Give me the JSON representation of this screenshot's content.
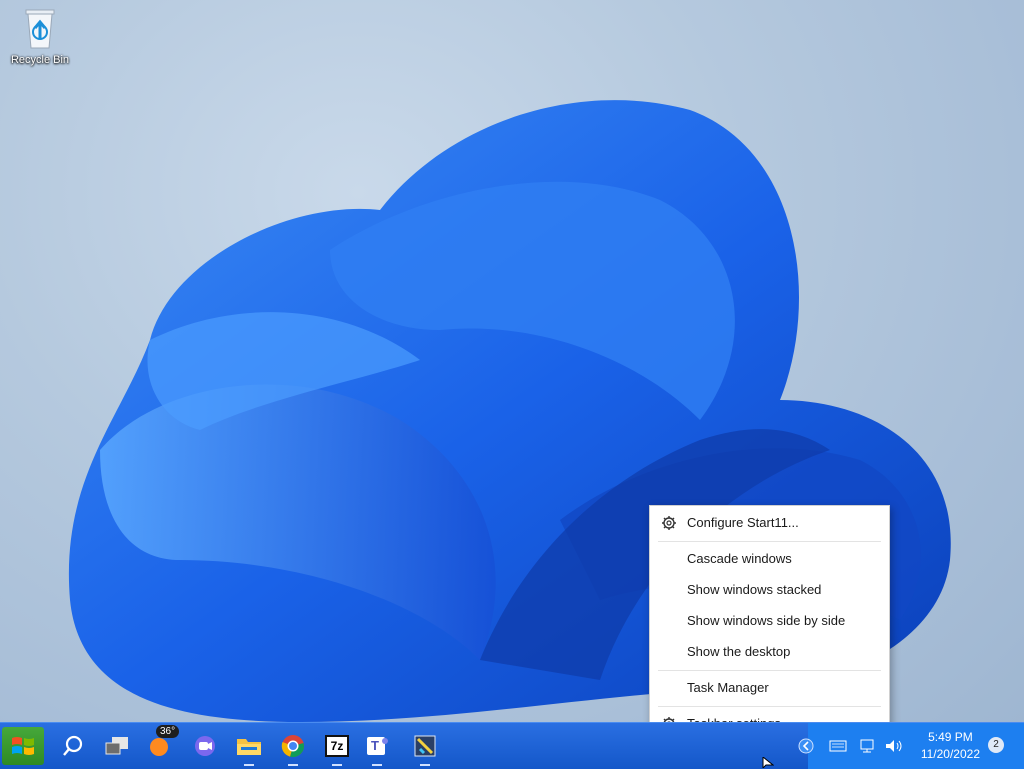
{
  "desktop": {
    "icons": [
      {
        "label": "Recycle Bin",
        "icon": "recycle-bin-icon"
      }
    ]
  },
  "taskbar": {
    "start_icon": "windows-start-icon",
    "pinned": [
      {
        "name": "search",
        "icon": "search-icon"
      },
      {
        "name": "task-view",
        "icon": "task-view-icon"
      },
      {
        "name": "weather",
        "icon": "weather-icon",
        "badge": "36°"
      },
      {
        "name": "teams-chat",
        "icon": "meet-chat-icon"
      },
      {
        "name": "file-explorer",
        "icon": "folder-icon"
      },
      {
        "name": "chrome",
        "icon": "chrome-icon"
      },
      {
        "name": "7zip",
        "icon": "7zip-icon",
        "text": "7z"
      },
      {
        "name": "teams",
        "icon": "teams-icon",
        "text": "T"
      },
      {
        "name": "app",
        "icon": "app-icon"
      }
    ],
    "tray": {
      "time": "5:49 PM",
      "date": "11/20/2022",
      "notifications": "2"
    }
  },
  "context_menu": {
    "items": [
      {
        "label": "Configure Start11...",
        "icon": "gear-icon"
      },
      {
        "label": "Cascade windows"
      },
      {
        "label": "Show windows stacked"
      },
      {
        "label": "Show windows side by side"
      },
      {
        "label": "Show the desktop"
      },
      {
        "label": "Task Manager"
      },
      {
        "label": "Taskbar settings",
        "icon": "gear-icon"
      }
    ]
  },
  "colors": {
    "taskbar": "#1a5fd6",
    "tray": "#1d7ff0",
    "accent": "#2b6ef2"
  }
}
